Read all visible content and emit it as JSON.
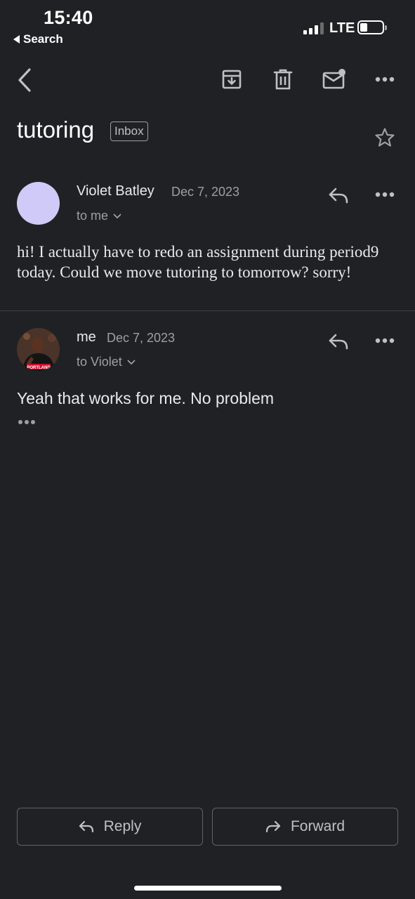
{
  "status_bar": {
    "time": "15:40",
    "back_app": "Search",
    "network": "LTE"
  },
  "toolbar": {
    "icons": [
      "back-icon",
      "archive-icon",
      "trash-icon",
      "mark-unread-icon",
      "more-icon"
    ]
  },
  "thread": {
    "subject": "tutoring",
    "label": "Inbox"
  },
  "messages": [
    {
      "sender": "Violet Batley",
      "date": "Dec 7, 2023",
      "recipient": "to me",
      "body": "hi! I actually have to redo an assignment during period9 today. Could we move tutoring to tomorrow? sorry!"
    },
    {
      "sender": "me",
      "date": "Dec 7, 2023",
      "recipient": "to Violet",
      "body": "Yeah that works for me. No problem"
    }
  ],
  "actions": {
    "reply": "Reply",
    "forward": "Forward"
  },
  "colors": {
    "background": "#202124",
    "text": "#e8eaed",
    "secondary": "#9aa0a6",
    "violet_avatar": "#cfcaf7"
  }
}
